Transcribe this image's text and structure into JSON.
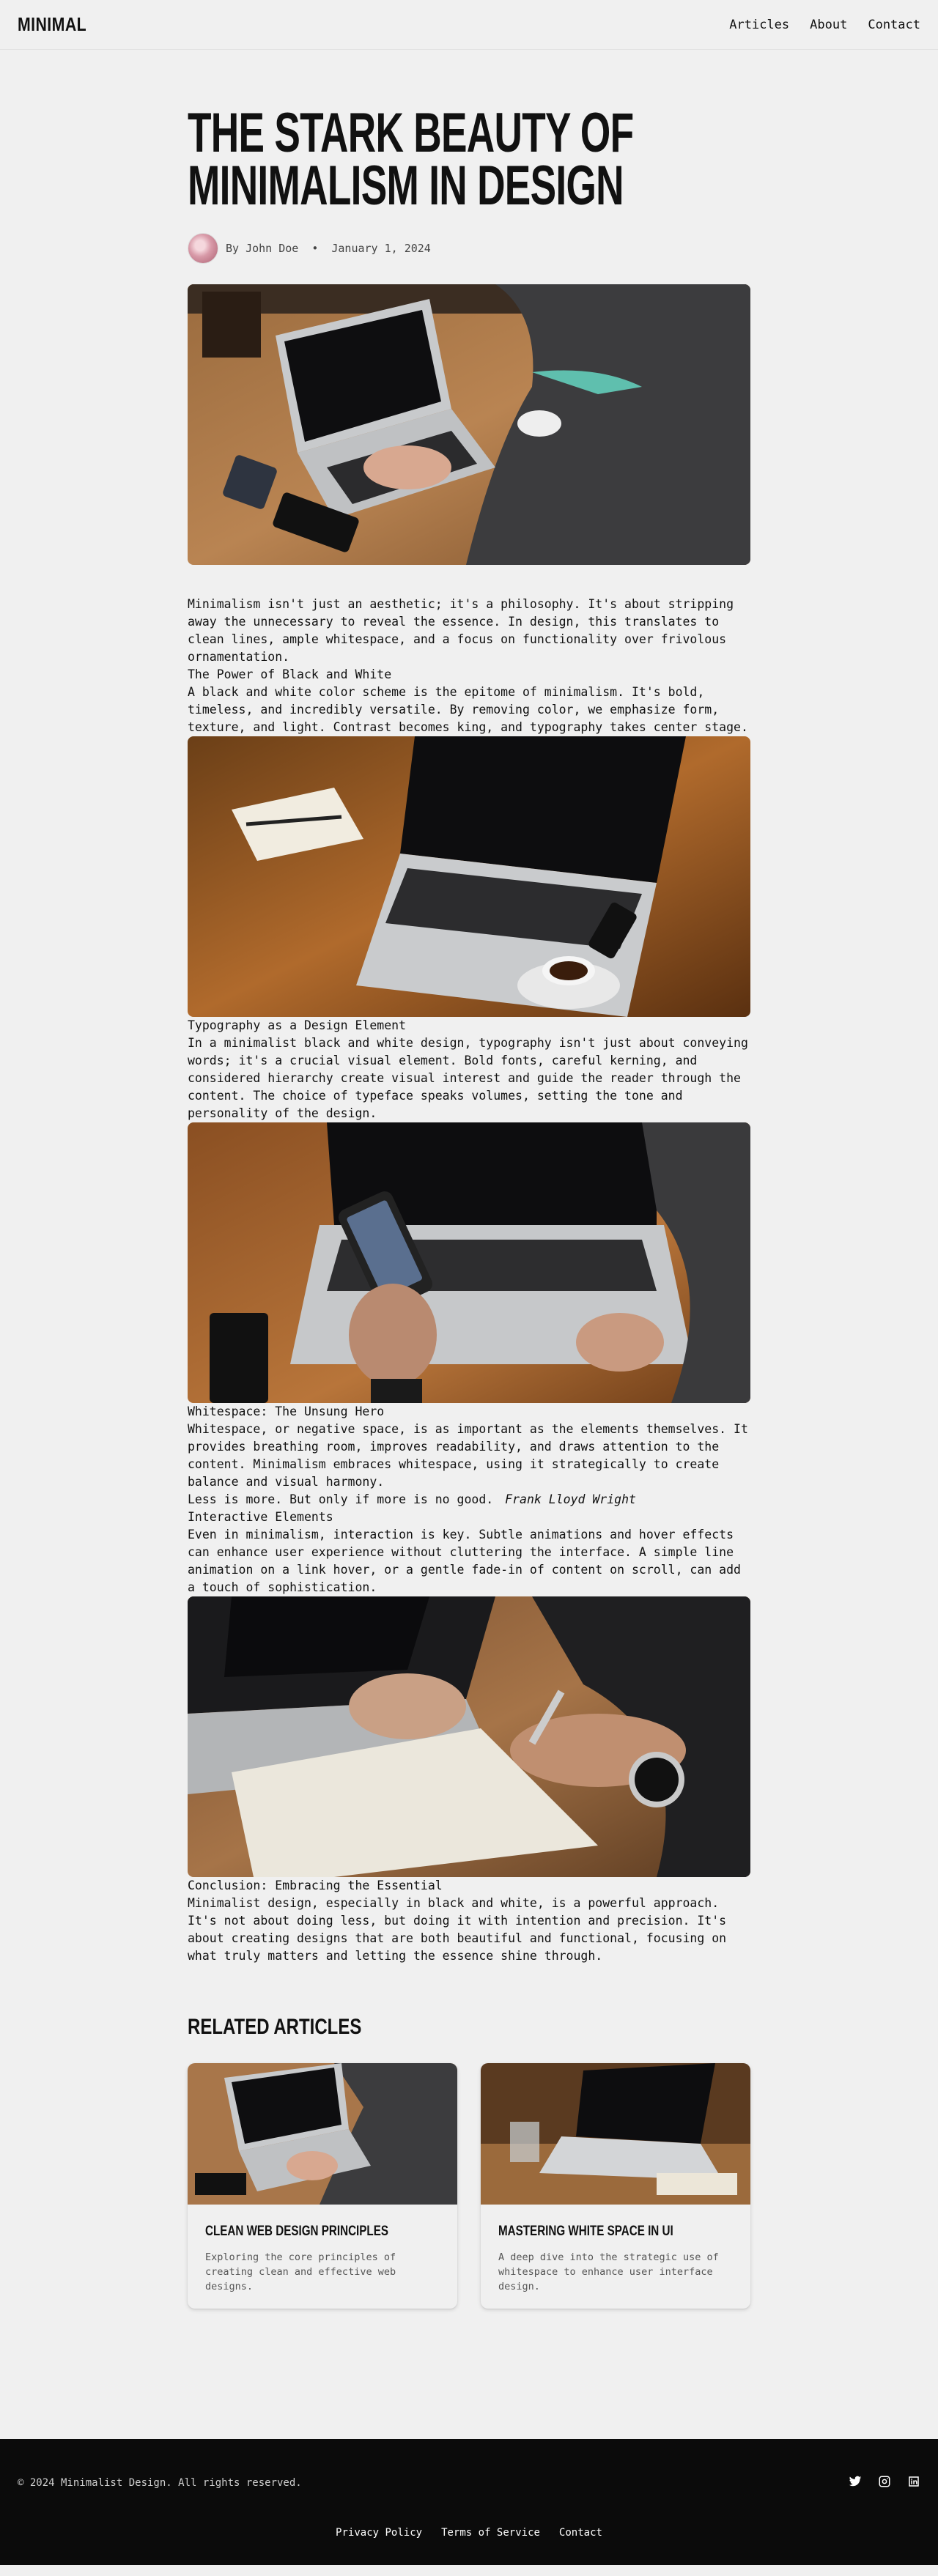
{
  "header": {
    "brand": "MINIMAL",
    "nav": [
      "Articles",
      "About",
      "Contact"
    ]
  },
  "article": {
    "title": "The Stark Beauty of Minimalism in Design",
    "author": "By John Doe",
    "date": "January 1, 2024",
    "intro": "Minimalism isn't just an aesthetic; it's a philosophy. It's about stripping away the unnecessary to reveal the essence. In design, this translates to clean lines, ample whitespace, and a focus on functionality over frivolous ornamentation.",
    "s1_heading": "The Power of Black and White",
    "s1_text": "A black and white color scheme is the epitome of minimalism. It's bold, timeless, and incredibly versatile. By removing color, we emphasize form, texture, and light. Contrast becomes king, and typography takes center stage.",
    "s2_heading": "Typography as a Design Element",
    "s2_text": "In a minimalist black and white design, typography isn't just about conveying words; it's a crucial visual element. Bold fonts, careful kerning, and considered hierarchy create visual interest and guide the reader through the content. The choice of typeface speaks volumes, setting the tone and personality of the design.",
    "s3_heading": "Whitespace: The Unsung Hero",
    "s3_text": "Whitespace, or negative space, is as important as the elements themselves. It provides breathing room, improves readability, and draws attention to the content. Minimalism embraces whitespace, using it strategically to create balance and visual harmony.",
    "quote": "Less is more. But only if more is no good.",
    "quote_author": "Frank Lloyd Wright",
    "s4_heading": "Interactive Elements",
    "s4_text": "Even in minimalism, interaction is key. Subtle animations and hover effects can enhance user experience without cluttering the interface. A simple line animation on a link hover, or a gentle fade-in of content on scroll, can add a touch of sophistication.",
    "s5_heading": "Conclusion: Embracing the Essential",
    "s5_text": "Minimalist design, especially in black and white, is a powerful approach. It's not about doing less, but doing it with intention and precision. It's about creating designs that are both beautiful and functional, focusing on what truly matters and letting the essence shine through."
  },
  "images": {
    "hero": "photo-laptop-typing",
    "img2": "photo-laptop-notebook-coffee",
    "img3": "photo-phone-over-laptop",
    "img4": "photo-writing-notebook-watch"
  },
  "related": {
    "heading": "Related Articles",
    "cards": [
      {
        "title": "Clean Web Design Principles",
        "text": "Exploring the core principles of creating clean and effective web designs.",
        "image": "photo-laptop-typing"
      },
      {
        "title": "Mastering White Space in UI",
        "text": "A deep dive into the strategic use of whitespace to enhance user interface design.",
        "image": "photo-laptop-desk"
      }
    ]
  },
  "footer": {
    "copyright": "© 2024 Minimalist Design. All rights reserved.",
    "social_icons": [
      "twitter-icon",
      "instagram-icon",
      "linkedin-icon"
    ],
    "links": [
      "Privacy Policy",
      "Terms of Service",
      "Contact"
    ]
  },
  "colors": {
    "background": "#f0f0f0",
    "text": "#111111",
    "footer_bg": "#0b0b0b"
  }
}
